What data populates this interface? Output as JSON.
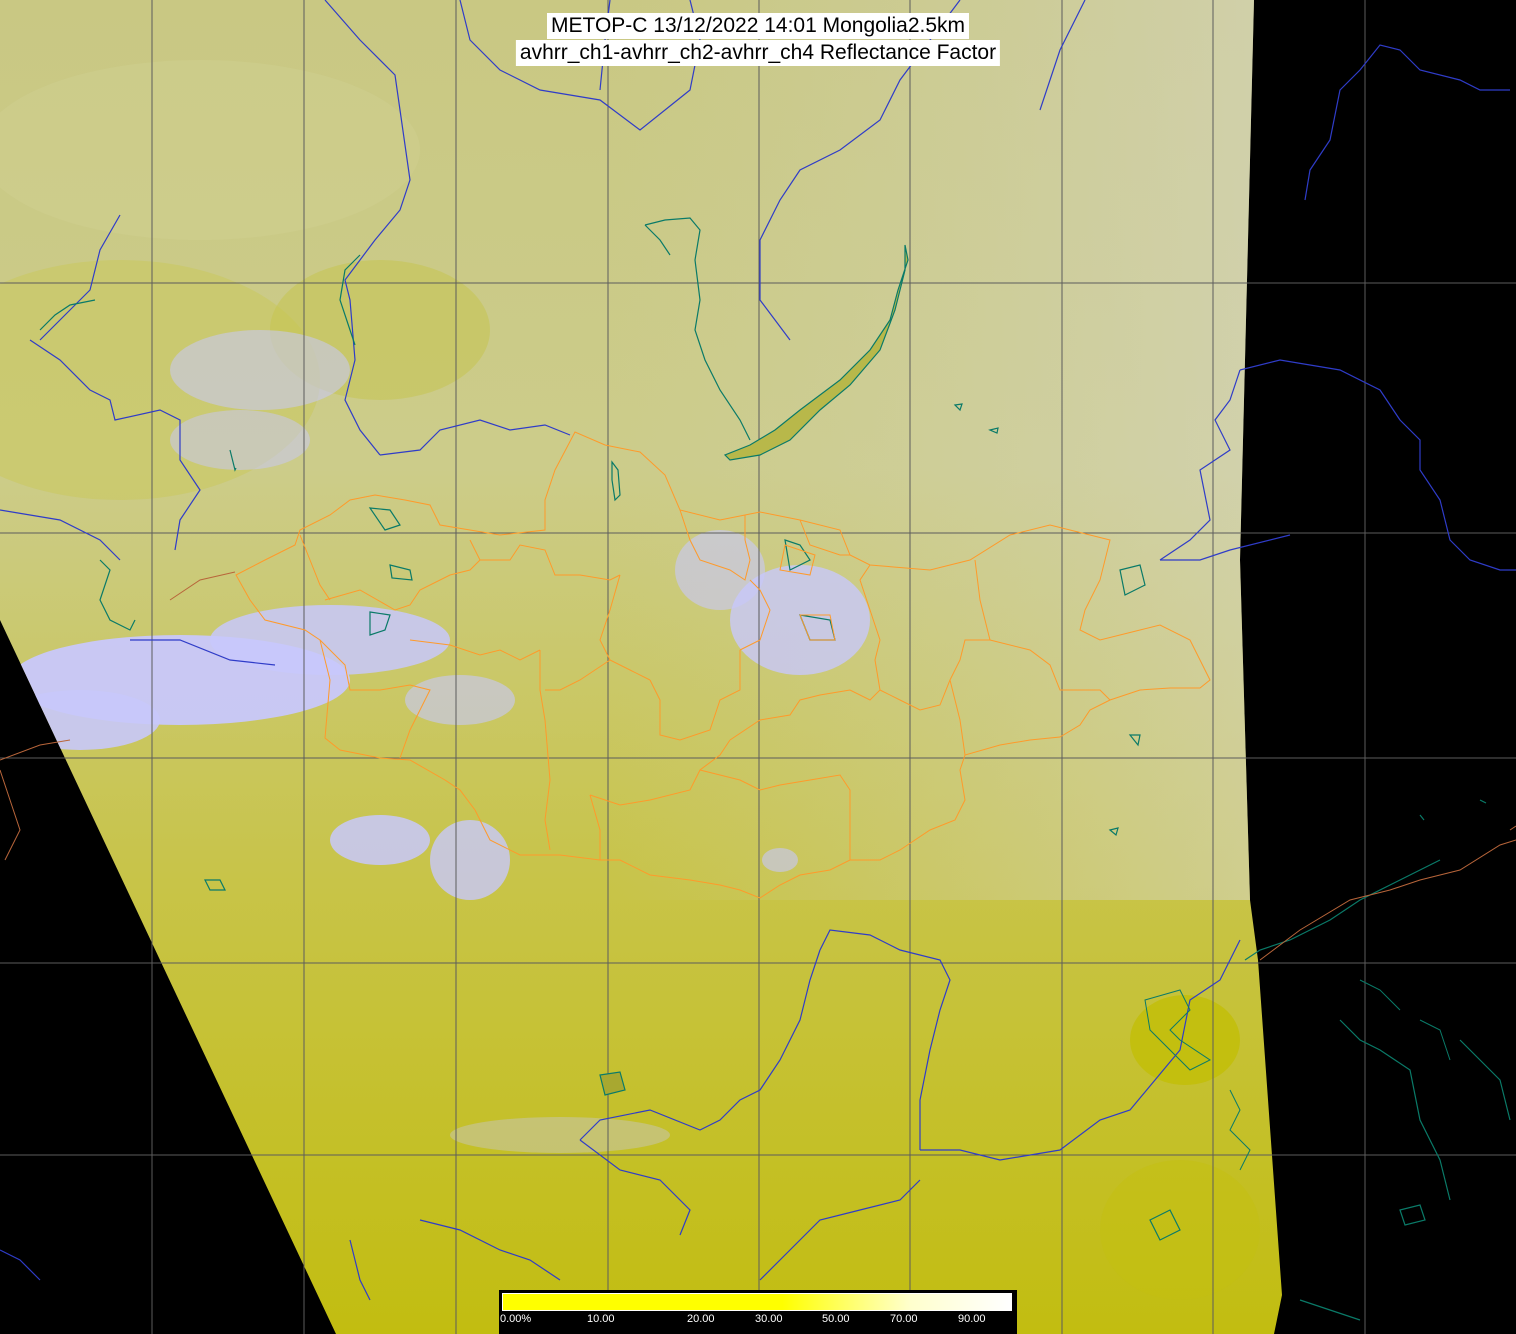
{
  "title": {
    "line1": "METOP-C 13/12/2022 14:01 Mongolia2.5km",
    "line2": "avhrr_ch1-avhrr_ch2-avhrr_ch4 Reflectance Factor"
  },
  "colorbar": {
    "labels": [
      "0.00%",
      "10.00",
      "20.00",
      "30.00",
      "50.00",
      "70.00",
      "90.00"
    ],
    "colors": [
      "#ffff00",
      "#ffffcc",
      "#ffffff"
    ]
  },
  "colors": {
    "background": "#000000",
    "land_low": "#c8c400",
    "land_high": "#d8d8a0",
    "cloud": "#c8c8ff",
    "grid": "#606060",
    "rivers": "#3030c0",
    "lakes": "#00806a",
    "admin_borders": "#ff9a2a",
    "country_borders": "#c06030"
  }
}
